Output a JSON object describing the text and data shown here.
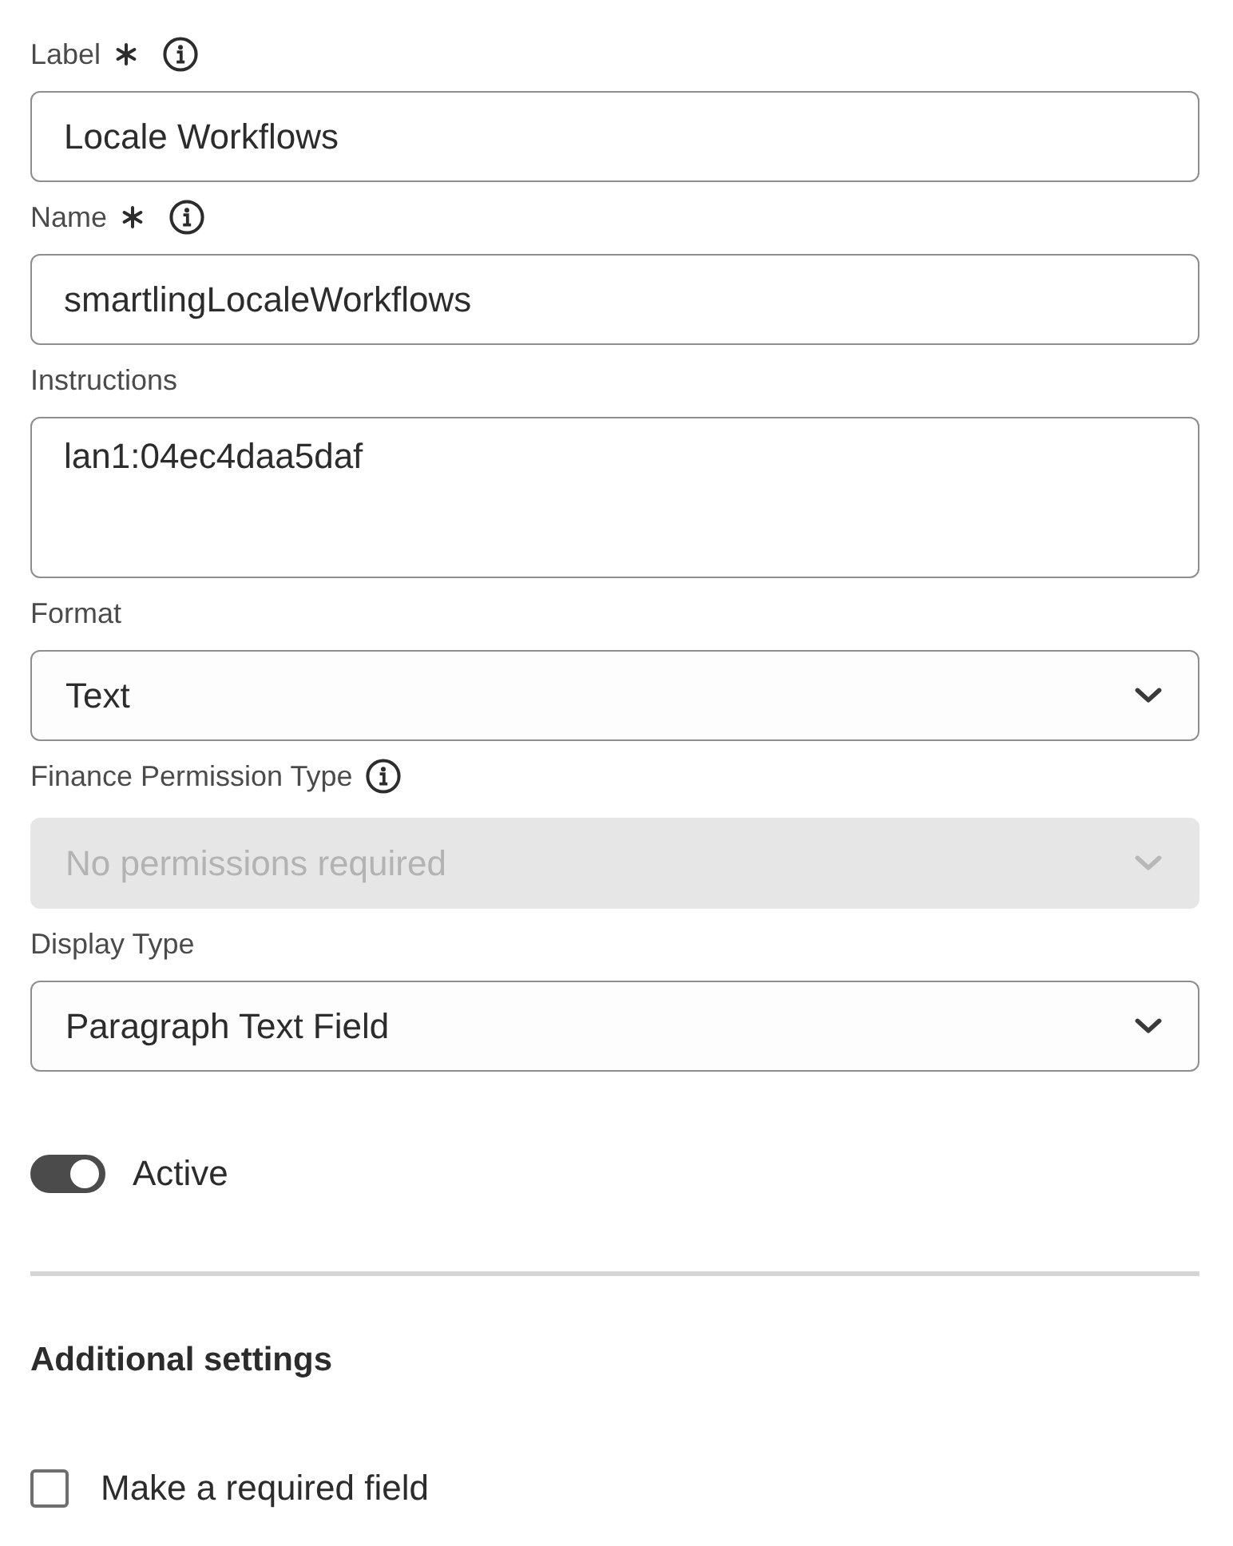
{
  "fields": [
    {
      "kind": "text",
      "label": "Label",
      "required": true,
      "info": true,
      "disabled": false,
      "value": "Locale Workflows"
    },
    {
      "kind": "text",
      "label": "Name",
      "required": true,
      "info": true,
      "disabled": false,
      "value": "smartlingLocaleWorkflows"
    },
    {
      "kind": "textarea",
      "label": "Instructions",
      "required": false,
      "info": false,
      "disabled": false,
      "value": "lan1:04ec4daa5daf"
    },
    {
      "kind": "select",
      "label": "Format",
      "required": false,
      "info": false,
      "disabled": false,
      "value": "Text"
    },
    {
      "kind": "select",
      "label": "Finance Permission Type",
      "required": false,
      "info": true,
      "disabled": true,
      "value": "No permissions required"
    },
    {
      "kind": "select",
      "label": "Display Type",
      "required": false,
      "info": false,
      "disabled": false,
      "value": "Paragraph Text Field"
    }
  ],
  "toggle": {
    "label": "Active",
    "on": true
  },
  "additional_settings": {
    "title": "Additional settings",
    "options": [
      {
        "label": "Make a required field",
        "checked": false
      }
    ]
  }
}
